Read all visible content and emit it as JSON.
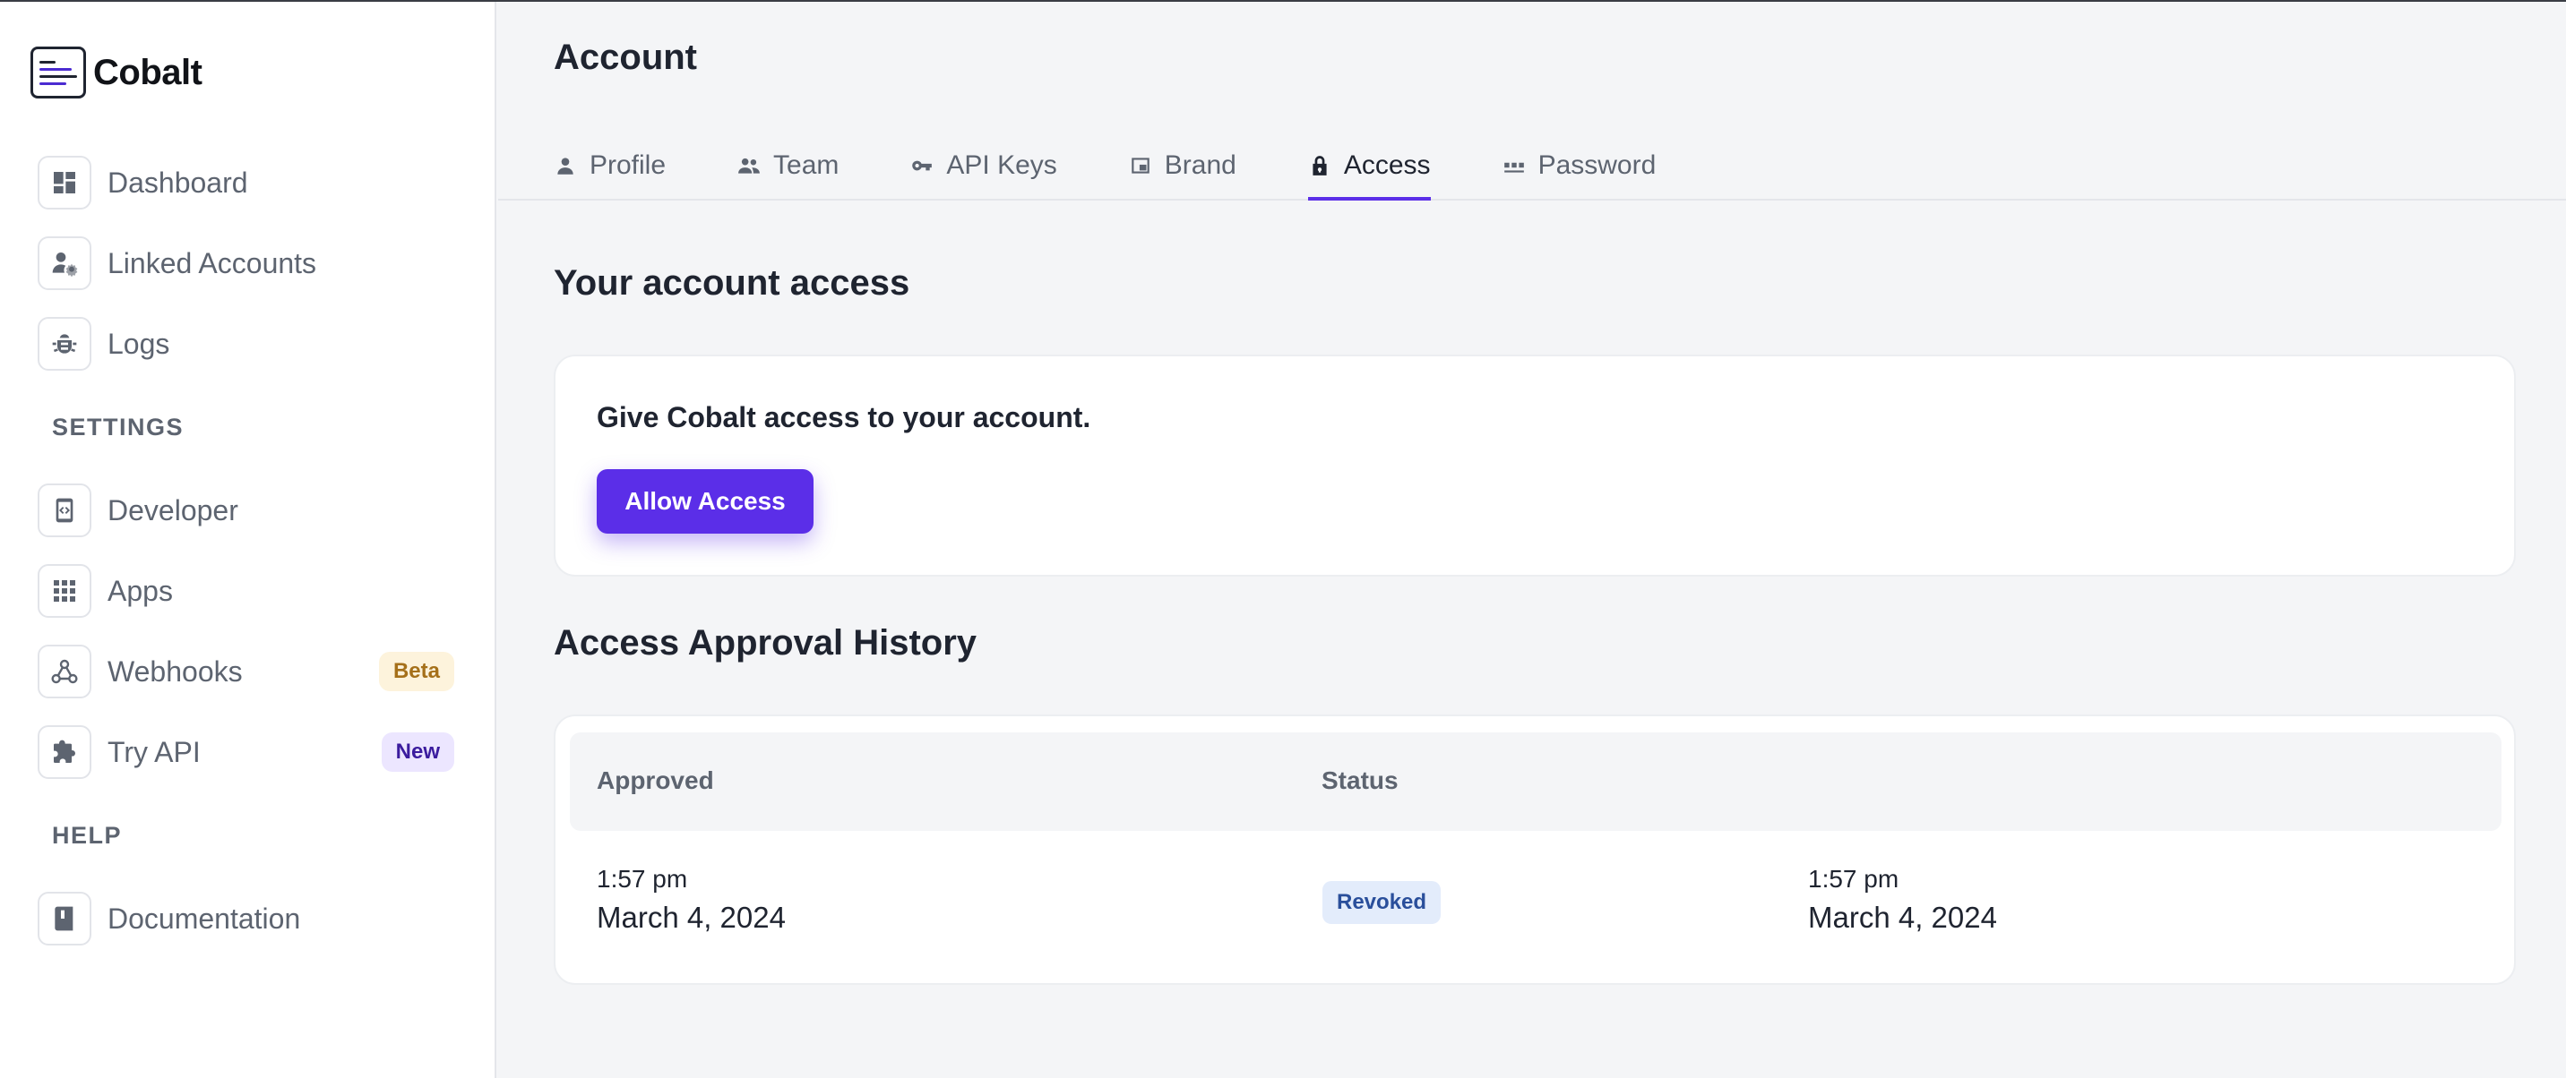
{
  "app": {
    "name": "Cobalt"
  },
  "sidebar": {
    "items": [
      {
        "label": "Dashboard",
        "icon": "dashboard-icon"
      },
      {
        "label": "Linked Accounts",
        "icon": "user-gear-icon"
      },
      {
        "label": "Logs",
        "icon": "bug-icon"
      }
    ],
    "settings_label": "SETTINGS",
    "settings_items": [
      {
        "label": "Developer",
        "icon": "developer-icon"
      },
      {
        "label": "Apps",
        "icon": "apps-grid-icon"
      },
      {
        "label": "Webhooks",
        "icon": "webhook-icon",
        "badge": "Beta"
      },
      {
        "label": "Try API",
        "icon": "puzzle-icon",
        "badge": "New"
      }
    ],
    "help_label": "HELP",
    "help_items": [
      {
        "label": "Documentation",
        "icon": "book-icon"
      }
    ]
  },
  "header": {
    "title": "Account",
    "tabs": [
      {
        "label": "Profile",
        "icon": "person-icon"
      },
      {
        "label": "Team",
        "icon": "team-icon"
      },
      {
        "label": "API Keys",
        "icon": "key-icon"
      },
      {
        "label": "Brand",
        "icon": "brand-icon"
      },
      {
        "label": "Access",
        "icon": "lock-icon",
        "active": true
      },
      {
        "label": "Password",
        "icon": "password-dots-icon"
      }
    ]
  },
  "access": {
    "heading": "Your account access",
    "description": "Give Cobalt access to your account.",
    "button_label": "Allow Access"
  },
  "history": {
    "heading": "Access Approval History",
    "columns": [
      "Approved",
      "Status",
      ""
    ],
    "rows": [
      {
        "approved_time": "1:57 pm",
        "approved_date": "March 4, 2024",
        "status": "Revoked",
        "revoked_time": "1:57 pm",
        "revoked_date": "March 4, 2024"
      }
    ]
  },
  "colors": {
    "accent": "#5b2ee8",
    "beta_badge_bg": "#fdf3dc",
    "new_badge_bg": "#ece6ff",
    "revoked_badge_bg": "#e3ecfb"
  }
}
